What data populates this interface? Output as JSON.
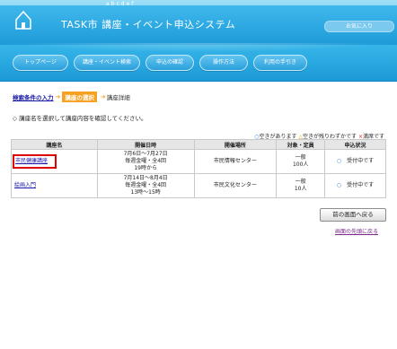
{
  "header": {
    "deco_text": "abcdef",
    "title": "TASK市 講座・イベント申込システム",
    "top_link": "お気に入り"
  },
  "nav": [
    {
      "label": "トップページ"
    },
    {
      "label": "講座・イベント検索"
    },
    {
      "label": "申込の確認"
    },
    {
      "label": "操作方法"
    },
    {
      "label": "利用の手引き"
    }
  ],
  "breadcrumb": {
    "step1": "検索条件の入力",
    "step2": "講座の選択",
    "step3": "講座詳細"
  },
  "instruction": "◇ 講座名を選択して講座内容を確認してください。",
  "legend": {
    "available_mark": "○",
    "available": "空きがあります",
    "few_mark": "△",
    "few": "空きが残りわずかです",
    "full_mark": "×",
    "full": "満席です"
  },
  "table": {
    "headers": [
      "講座名",
      "開催日時",
      "開催場所",
      "対象・定員",
      "申込状況"
    ],
    "rows": [
      {
        "name": "市民健康講座",
        "date1": "7月6日～7月27日",
        "date2": "毎週金曜・全4回",
        "date3": "19時から",
        "place": "市民情報センター",
        "target": "一般",
        "capacity": "100人",
        "status_mark": "○",
        "status": "受付中です"
      },
      {
        "name": "絵画入門",
        "date1": "7月14日～8月4日",
        "date2": "毎週金曜・全4回",
        "date3": "13時～15時",
        "place": "市民文化センター",
        "target": "一般",
        "capacity": "10人",
        "status_mark": "○",
        "status": "受付中です"
      }
    ]
  },
  "back_button": "前の画面へ戻る",
  "top_of_page": "画面の先頭に戻る",
  "colors": {
    "header_blue": "#1e9bd8",
    "link_blue": "#1a1aa8",
    "active_orange": "#f6a122",
    "highlight_red": "#e00000"
  }
}
